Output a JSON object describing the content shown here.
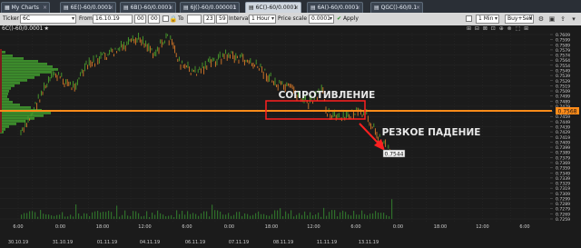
{
  "tabs": [
    {
      "label": "My Charts",
      "active": false
    },
    {
      "label": "6E()-60/0.0001",
      "active": false
    },
    {
      "label": "6B()-60/0.0001",
      "active": false
    },
    {
      "label": "6J()-60/0.000001",
      "active": false
    },
    {
      "label": "6C()-60/0.0001",
      "active": true
    },
    {
      "label": "6A()-60/0.0001",
      "active": false
    },
    {
      "label": "QGC()-60/0.1",
      "active": false
    }
  ],
  "toolbar": {
    "ticker_label": "Ticker",
    "ticker_value": "6C",
    "from_label": "From",
    "from_date": "16.10.19",
    "from_hour": "00",
    "from_min": "00",
    "to_label": "To",
    "to_hour": "23",
    "to_min": "59",
    "interval_label": "Interval",
    "interval_value": "1 Hour",
    "price_scale_label": "Price scale",
    "price_scale_value": "0.0001",
    "apply_label": "Apply",
    "timeframe_value": "1 Min",
    "side_value": "Buy+Sell"
  },
  "instrument_title": "6C()-60/0.0001",
  "chart": {
    "price_levels": [
      "0.7609",
      "0.7599",
      "0.7589",
      "0.7579",
      "0.7574",
      "0.7564",
      "0.7554",
      "0.7549",
      "0.7539",
      "0.7529",
      "0.7519",
      "0.7509",
      "0.7499",
      "0.7489",
      "0.7479",
      "0.7469",
      "0.7459",
      "0.7449",
      "0.7439",
      "0.7429",
      "0.7419",
      "0.7409",
      "0.7399",
      "0.7389",
      "0.7379",
      "0.7369",
      "0.7359",
      "0.7349",
      "0.7339",
      "0.7329",
      "0.7319",
      "0.7309",
      "0.7299",
      "0.7289",
      "0.7279",
      "0.7269",
      "0.7259"
    ],
    "current_price": "0.7568",
    "last_price": "0.7544",
    "time_labels": [
      "6:00",
      "20:00",
      "10:00",
      "0:00",
      "14:00",
      "4:00",
      "18:00",
      "8:00",
      "22:00",
      "12:00",
      "2:00",
      "16:00",
      "6:00",
      "20:00",
      "10:00",
      "0:00",
      "14:00",
      "4:00",
      "18:00",
      "8:00",
      "22:00",
      "12:00",
      "2:00",
      "16:00",
      "6:00",
      "20:00",
      "10:00",
      "0:00",
      "14:00",
      "4:00",
      "18:00",
      "8:00",
      "22:00",
      "12:00",
      "2:00",
      "16:00",
      "6:00"
    ],
    "date_labels": [
      "30.10.19",
      "31.10.19",
      "01.11.19",
      "04.11.19",
      "06.11.19",
      "07.11.19",
      "08.11.19",
      "11.11.19",
      "13.11.19"
    ],
    "resistance_label": "СОПРОТИВЛЕНИЕ",
    "drop_label": "РЕЗКОЕ ПАДЕНИЕ",
    "colors": {
      "up": "#4aa02c",
      "down": "#d87828",
      "resistance_line": "#ff8c1a",
      "annotation_box": "#ff2020",
      "arrow": "#ff2020",
      "profile": "#3c8a2c"
    }
  }
}
